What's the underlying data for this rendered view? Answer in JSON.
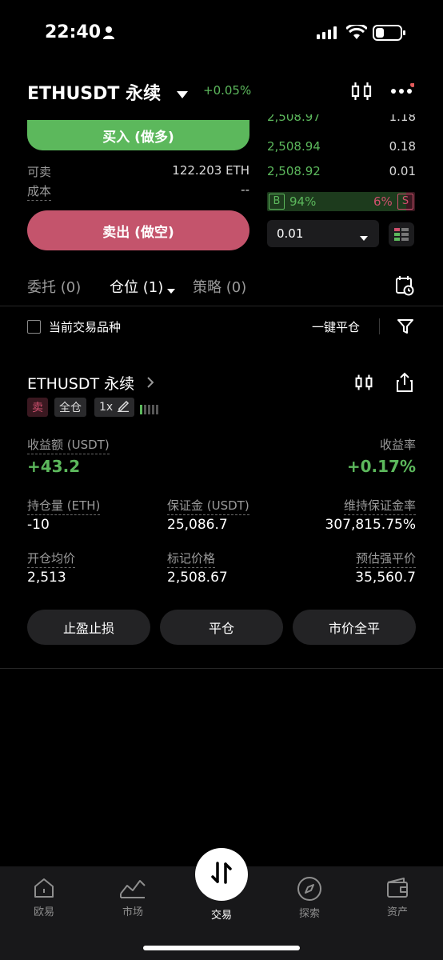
{
  "status_bar": {
    "time": "22:40"
  },
  "header": {
    "pair": "ETHUSDT 永续",
    "change": "+0.05%"
  },
  "order_book": {
    "partial_top": {
      "price": "2,508.97",
      "qty": "1.18"
    },
    "rows": [
      {
        "price": "2,508.94",
        "qty": "0.18"
      },
      {
        "price": "2,508.92",
        "qty": "0.01"
      }
    ],
    "buy_ratio_label": "B",
    "buy_ratio": "94%",
    "sell_ratio": "6%",
    "sell_ratio_label": "S",
    "depth_value": "0.01"
  },
  "order_form": {
    "buy_label": "买入 (做多)",
    "sellable_label": "可卖",
    "sellable_value": "122.203 ETH",
    "cost_label": "成本",
    "cost_value": "--",
    "sell_label": "卖出 (做空)"
  },
  "tabs": [
    {
      "label": "委托 (0)"
    },
    {
      "label": "仓位 (1)"
    },
    {
      "label": "策略 (0)"
    }
  ],
  "filter": {
    "current_symbol_label": "当前交易品种",
    "close_all_label": "一键平仓"
  },
  "position": {
    "pair": "ETHUSDT 永续",
    "side_tag": "卖",
    "margin_mode": "全仓",
    "leverage": "1x",
    "pnl_label": "收益额 (USDT)",
    "pnl_value": "+43.2",
    "roi_label": "收益率",
    "roi_value": "+0.17%",
    "size_label": "持仓量 (ETH)",
    "size_value": "-10",
    "margin_label": "保证金 (USDT)",
    "margin_value": "25,086.7",
    "mmr_label": "维持保证金率",
    "mmr_value": "307,815.75%",
    "entry_label": "开仓均价",
    "entry_value": "2,513",
    "mark_label": "标记价格",
    "mark_value": "2,508.67",
    "liq_label": "预估强平价",
    "liq_value": "35,560.7",
    "tp_sl_label": "止盈止损",
    "close_label": "平仓",
    "market_close_label": "市价全平"
  },
  "bottom_nav": [
    {
      "label": "欧易",
      "icon": "home-icon"
    },
    {
      "label": "市场",
      "icon": "market-chart-icon"
    },
    {
      "label": "交易",
      "icon": "trade-swap-icon"
    },
    {
      "label": "探索",
      "icon": "compass-icon"
    },
    {
      "label": "资产",
      "icon": "wallet-icon"
    }
  ],
  "colors": {
    "green": "#5cb85c",
    "red": "#d0506e",
    "background": "#000000"
  }
}
